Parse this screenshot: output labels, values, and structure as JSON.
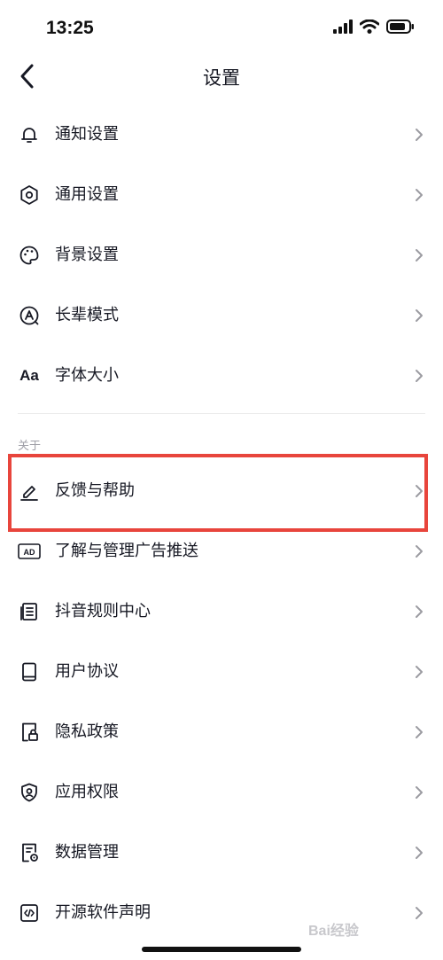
{
  "status_bar": {
    "time": "13:25"
  },
  "header": {
    "title": "设置"
  },
  "items_top": [
    {
      "label": "通知设置",
      "icon": "bell-icon"
    },
    {
      "label": "通用设置",
      "icon": "gear-icon"
    },
    {
      "label": "背景设置",
      "icon": "palette-icon"
    },
    {
      "label": "长辈模式",
      "icon": "elder-mode-icon"
    },
    {
      "label": "字体大小",
      "icon": "font-size-icon",
      "icon_text": "Aa"
    }
  ],
  "section_about": {
    "label": "关于"
  },
  "items_about": [
    {
      "label": "反馈与帮助",
      "icon": "pencil-icon"
    },
    {
      "label": "了解与管理广告推送",
      "icon": "ad-icon",
      "icon_text": "AD"
    },
    {
      "label": "抖音规则中心",
      "icon": "document-icon"
    },
    {
      "label": "用户协议",
      "icon": "book-icon"
    },
    {
      "label": "隐私政策",
      "icon": "lock-doc-icon"
    },
    {
      "label": "应用权限",
      "icon": "shield-icon"
    },
    {
      "label": "数据管理",
      "icon": "data-file-icon"
    },
    {
      "label": "开源软件声明",
      "icon": "code-icon"
    }
  ],
  "highlight_color": "#e8453c",
  "watermark": "Bai经验"
}
